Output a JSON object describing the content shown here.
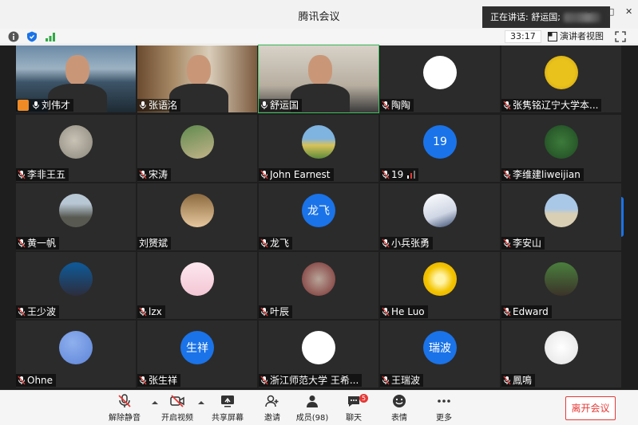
{
  "window": {
    "title": "腾讯会议"
  },
  "speaking": {
    "label": "正在讲话: 舒运国;"
  },
  "toolbar": {
    "timer": "33:17",
    "speaker_view": "演讲者视图"
  },
  "grid": {
    "tiles": [
      {
        "name": "刘伟才",
        "type": "video",
        "scene": "lake",
        "host": true
      },
      {
        "name": "张语洺",
        "type": "video",
        "scene": "books"
      },
      {
        "name": "舒运国",
        "type": "video",
        "scene": "office",
        "active": true
      },
      {
        "name": "陶陶",
        "type": "avatar",
        "avatar_style": "logo"
      },
      {
        "name": "张隽铭辽宁大学本...",
        "type": "avatar",
        "avatar_style": "keep-calm"
      },
      {
        "name": "李非王五",
        "type": "avatar",
        "avatar_style": "cat"
      },
      {
        "name": "宋涛",
        "type": "avatar",
        "avatar_style": "photo-green"
      },
      {
        "name": "John Earnest",
        "type": "avatar",
        "avatar_style": "field"
      },
      {
        "name": "19",
        "type": "avatar",
        "avatar_style": "initial",
        "initial": "19",
        "signal": true
      },
      {
        "name": "李维建liweijian",
        "type": "avatar",
        "avatar_style": "trees"
      },
      {
        "name": "黄一帆",
        "type": "avatar",
        "avatar_style": "statues"
      },
      {
        "name": "刘赟斌",
        "type": "avatar",
        "avatar_style": "cartoon",
        "no_mic": true
      },
      {
        "name": "龙飞",
        "type": "avatar",
        "avatar_style": "initial",
        "initial": "龙飞"
      },
      {
        "name": "小兵张勇",
        "type": "avatar",
        "avatar_style": "person-desk"
      },
      {
        "name": "李安山",
        "type": "avatar",
        "avatar_style": "beach"
      },
      {
        "name": "王少波",
        "type": "avatar",
        "avatar_style": "person-suit"
      },
      {
        "name": "lzx",
        "type": "avatar",
        "avatar_style": "girl"
      },
      {
        "name": "叶辰",
        "type": "avatar",
        "avatar_style": "bear-red"
      },
      {
        "name": "He Luo",
        "type": "avatar",
        "avatar_style": "sun"
      },
      {
        "name": "Edward",
        "type": "avatar",
        "avatar_style": "campus"
      },
      {
        "name": "Ohne",
        "type": "avatar",
        "avatar_style": "blue-plain"
      },
      {
        "name": "张生祥",
        "type": "avatar",
        "avatar_style": "initial",
        "initial": "生祥"
      },
      {
        "name": "浙江师范大学 王希...",
        "type": "avatar",
        "avatar_style": "cat-cartoon"
      },
      {
        "name": "王瑞波",
        "type": "avatar",
        "avatar_style": "initial",
        "initial": "瑞波"
      },
      {
        "name": "鳳鳴",
        "type": "avatar",
        "avatar_style": "sketch"
      }
    ]
  },
  "bottombar": {
    "unmute": "解除静音",
    "start_video": "开启视频",
    "share_screen": "共享屏幕",
    "invite": "邀请",
    "members": "成员(98)",
    "chat": "聊天",
    "chat_badge": "5",
    "reactions": "表情",
    "more": "更多",
    "leave": "离开会议"
  },
  "colors": {
    "accent": "#1a73e8",
    "danger": "#e53935",
    "grid_bg": "#1e1e1e",
    "tile_bg": "#2b2b2b"
  }
}
